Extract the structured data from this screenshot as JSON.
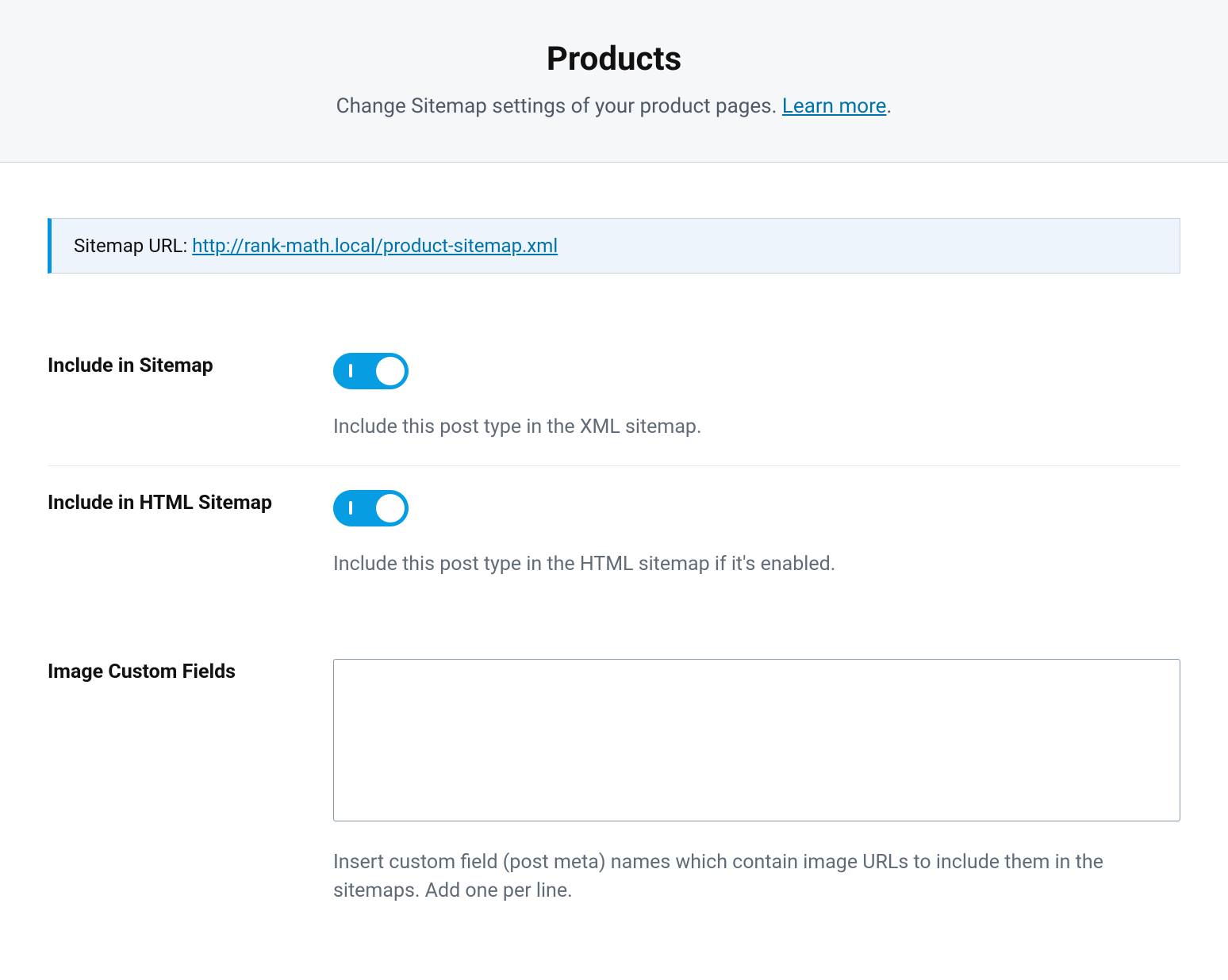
{
  "header": {
    "title": "Products",
    "subtitle_text": "Change Sitemap settings of your product pages. ",
    "learn_more": "Learn more",
    "subtitle_suffix": "."
  },
  "notice": {
    "label": "Sitemap URL: ",
    "url": "http://rank-math.local/product-sitemap.xml"
  },
  "settings": {
    "include_sitemap": {
      "label": "Include in Sitemap",
      "enabled": true,
      "description": "Include this post type in the XML sitemap."
    },
    "include_html_sitemap": {
      "label": "Include in HTML Sitemap",
      "enabled": true,
      "description": "Include this post type in the HTML sitemap if it's enabled."
    },
    "image_custom_fields": {
      "label": "Image Custom Fields",
      "value": "",
      "description": "Insert custom field (post meta) names which contain image URLs to include them in the sitemaps. Add one per line."
    }
  }
}
